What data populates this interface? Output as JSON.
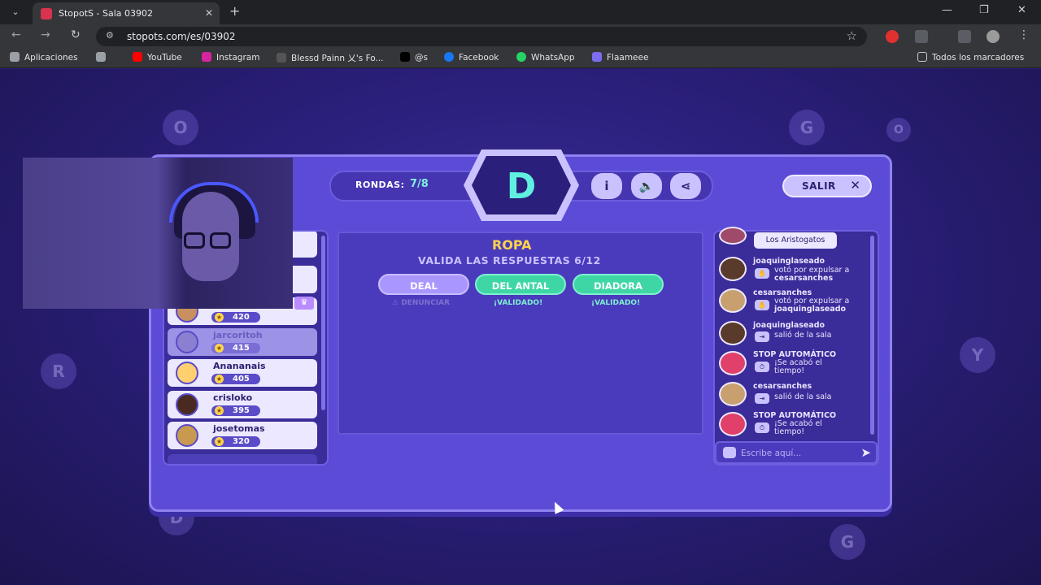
{
  "browser": {
    "tab_title": "StopotS - Sala 03902",
    "url": "stopots.com/es/03902",
    "bookmarks": [
      "Aplicaciones",
      "YouTube",
      "Instagram",
      "Blessd Painn 乂's Fo...",
      "@s",
      "Facebook",
      "WhatsApp",
      "Flaameee"
    ],
    "all_bookmarks": "Todos los marcadores"
  },
  "game": {
    "rounds_label": "RONDAS:",
    "rounds_value": "7/8",
    "letter": "D",
    "exit_label": "SALIR",
    "category": "ROPA",
    "validate_text": "VALIDA LAS RESPUESTAS 6/12",
    "answers": [
      {
        "label": "DEAL",
        "sub": "DENUNCIAR",
        "state": "pending"
      },
      {
        "label": "DEL ANTAL",
        "sub": "¡VALIDADO!",
        "state": "valid"
      },
      {
        "label": "DIADORA",
        "sub": "¡VALIDADO!",
        "state": "valid"
      }
    ],
    "players": [
      {
        "name": "",
        "score": "420"
      },
      {
        "name": "jarcoritoh",
        "score": "415"
      },
      {
        "name": "Anananais",
        "score": "405"
      },
      {
        "name": "crisloko",
        "score": "395"
      },
      {
        "name": "josetomas",
        "score": "320"
      }
    ]
  },
  "chat": {
    "team_tag": "Los Aristogatos",
    "messages": [
      {
        "user": "joaquinglaseado",
        "text": "votó por expulsar a",
        "target": "cesarsanches"
      },
      {
        "user": "cesarsanches",
        "text": "votó por expulsar a",
        "target": "joaquinglaseado"
      },
      {
        "user": "joaquinglaseado",
        "text": "salió de la sala",
        "target": ""
      },
      {
        "user": "STOP AUTOMÁTICO",
        "text": "¡Se acabó el tiempo!",
        "target": ""
      },
      {
        "user": "cesarsanches",
        "text": "salió de la sala",
        "target": ""
      },
      {
        "user": "STOP AUTOMÁTICO",
        "text": "¡Se acabó el tiempo!",
        "target": ""
      }
    ],
    "placeholder": "Escribe aquí..."
  },
  "colors": {
    "accent_yellow": "#ffd34d",
    "valid_green": "#3fd6a6",
    "board_purple": "#5b4bd6"
  }
}
